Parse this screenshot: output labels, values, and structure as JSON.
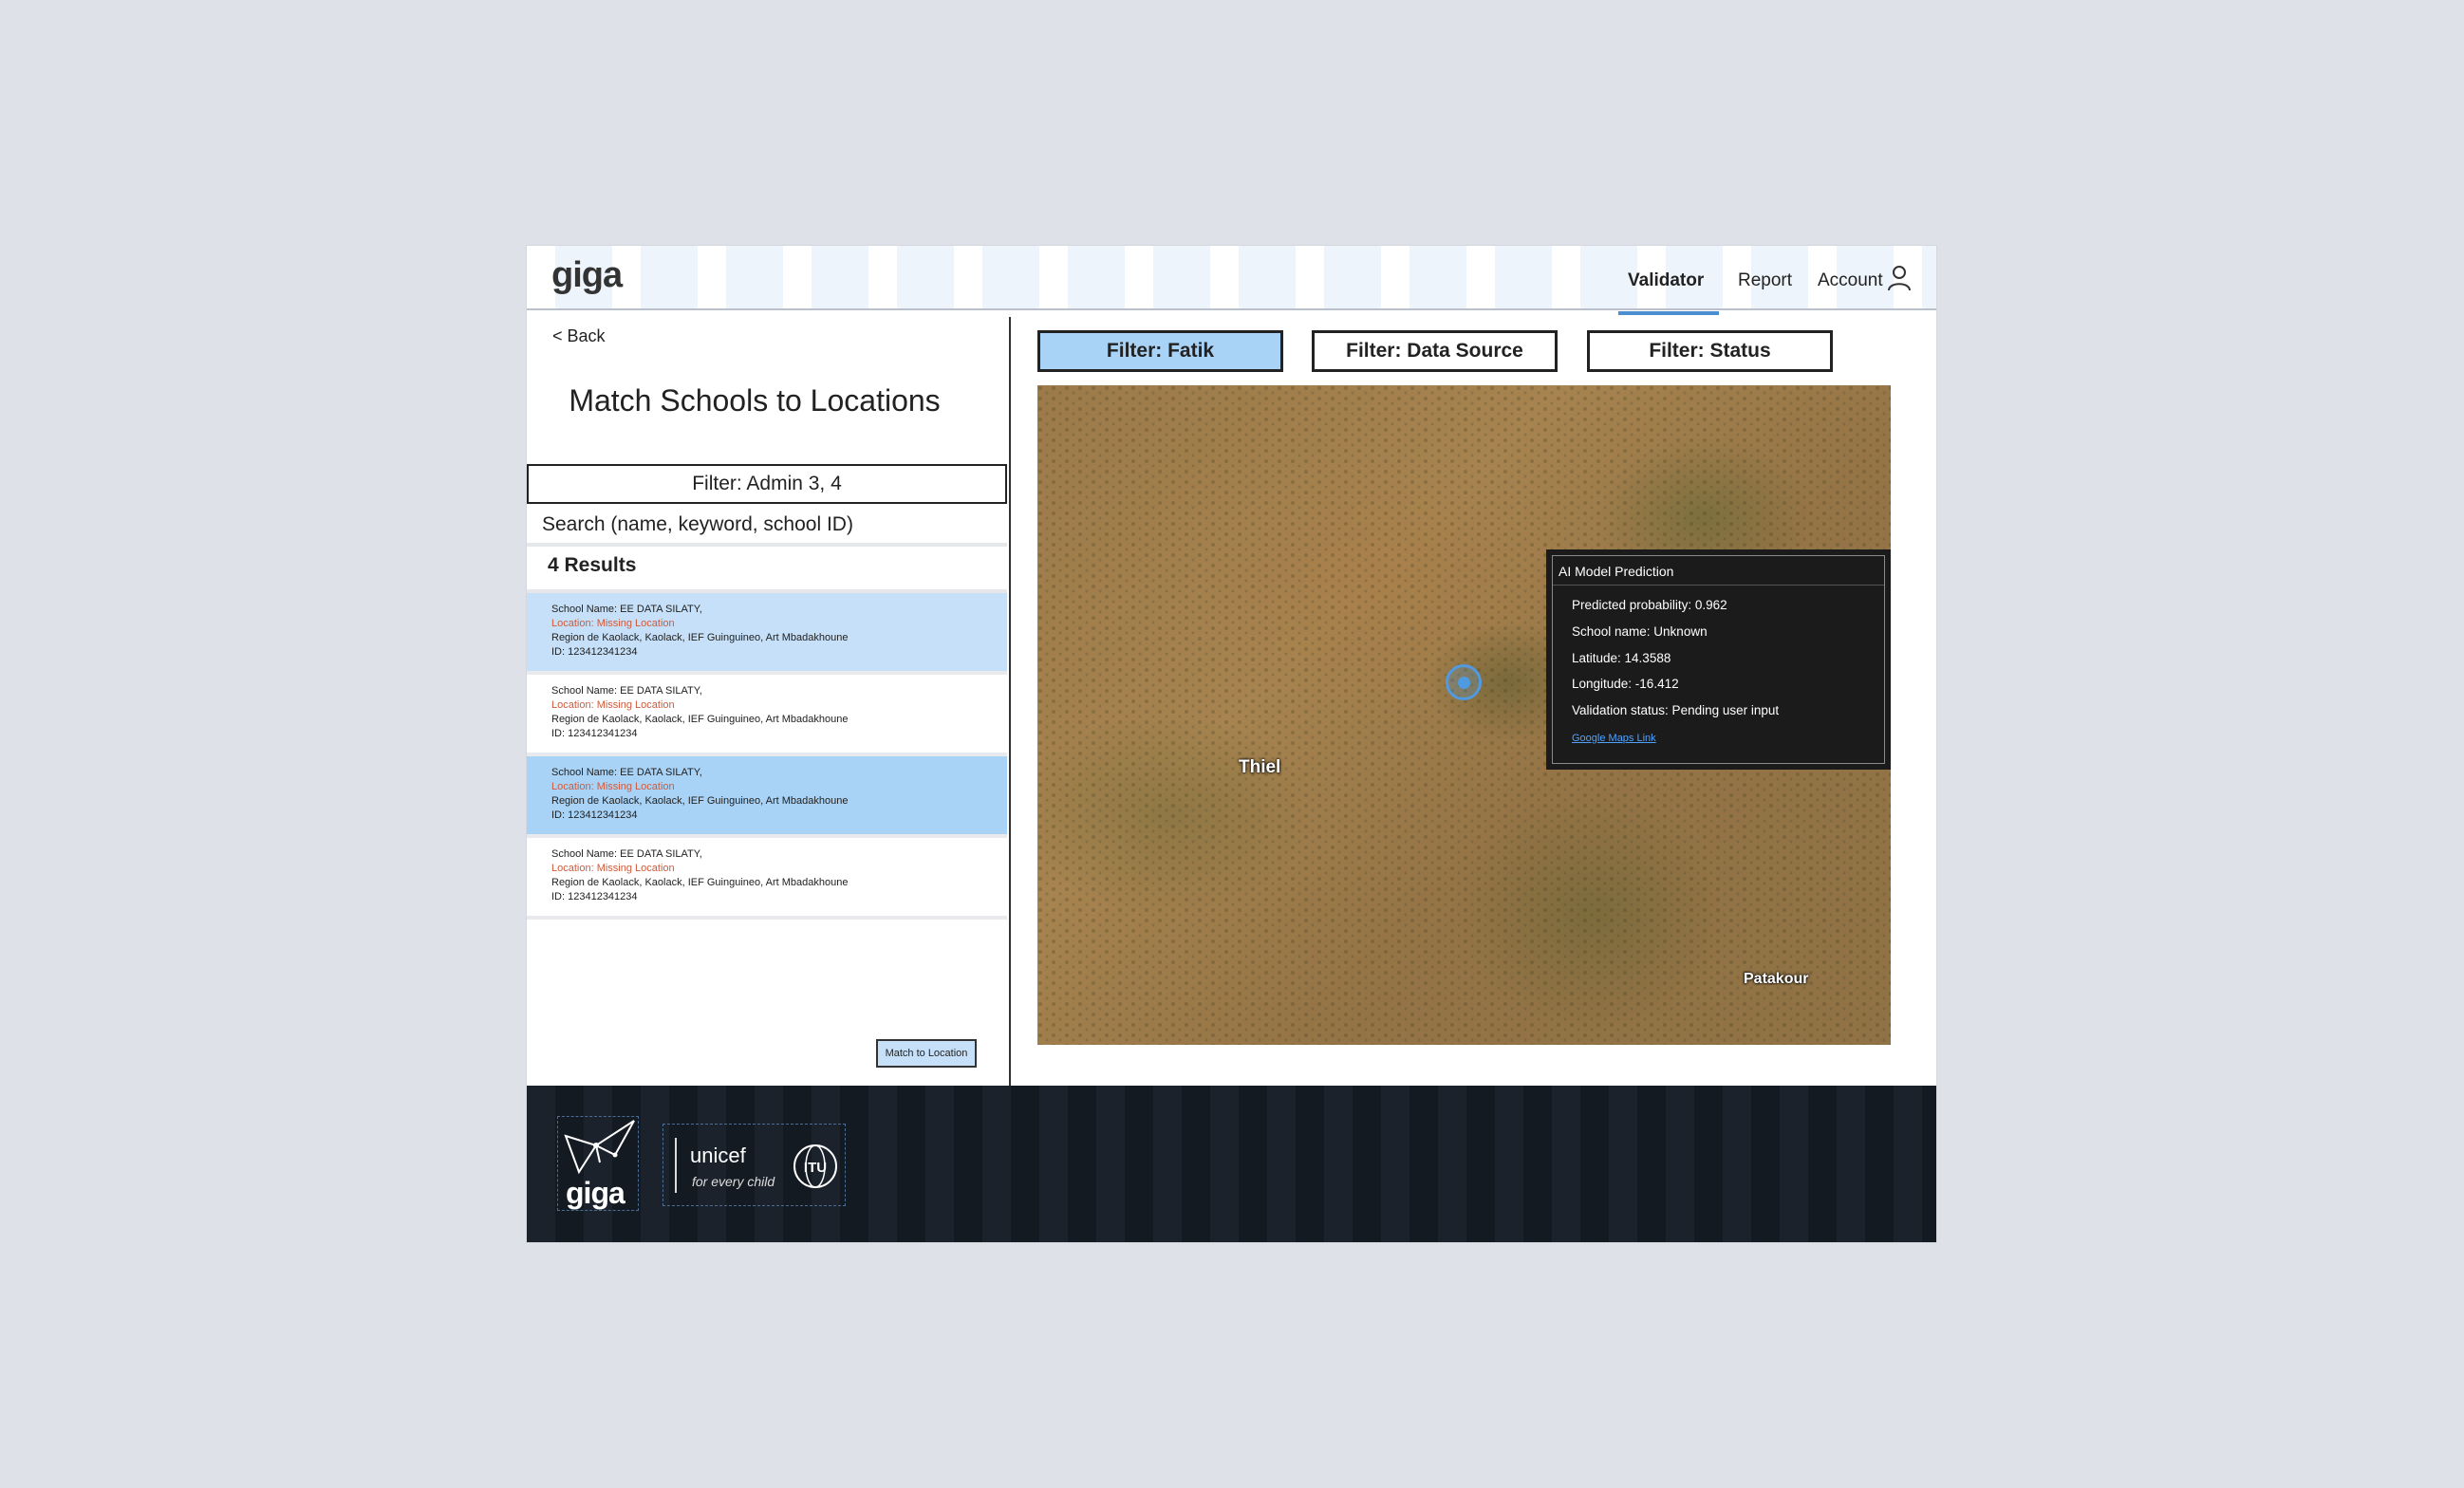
{
  "header": {
    "brand": "giga",
    "nav": {
      "validator": "Validator",
      "report": "Report",
      "account": "Account"
    }
  },
  "left_panel": {
    "back": "< Back",
    "title": "Match Schools to Locations",
    "admin_filter": "Filter: Admin 3, 4",
    "search_placeholder": "Search (name, keyword, school ID)",
    "results_count": "4 Results",
    "results": [
      {
        "name": "School Name: EE DATA SILATY,",
        "location": "Location: Missing Location",
        "region": "Region de Kaolack, Kaolack, IEF Guinguineo, Art Mbadakhoune",
        "id": "ID: 123412341234"
      },
      {
        "name": "School Name: EE DATA SILATY,",
        "location": "Location: Missing Location",
        "region": "Region de Kaolack, Kaolack, IEF Guinguineo, Art Mbadakhoune",
        "id": "ID: 123412341234"
      },
      {
        "name": "School Name: EE DATA SILATY,",
        "location": "Location: Missing Location",
        "region": "Region de Kaolack, Kaolack, IEF Guinguineo, Art Mbadakhoune",
        "id": "ID: 123412341234"
      },
      {
        "name": "School Name: EE DATA SILATY,",
        "location": "Location: Missing Location",
        "region": "Region de Kaolack, Kaolack, IEF Guinguineo, Art Mbadakhoune",
        "id": "ID: 123412341234"
      }
    ],
    "match_button": "Match to Location"
  },
  "filters": {
    "fatik": "Filter: Fatik",
    "data_source": "Filter: Data Source",
    "status": "Filter: Status"
  },
  "map": {
    "places": {
      "thiel": "Thiel",
      "patakour": "Patakour"
    },
    "popup": {
      "title": "AI Model Prediction",
      "probability": "Predicted probability: 0.962",
      "school_name": "School name: Unknown",
      "latitude": "Latitude: 14.3588",
      "longitude": "Longitude: -16.412",
      "status": "Validation status: Pending user input",
      "link": "Google Maps Link"
    }
  },
  "footer": {
    "giga": "giga",
    "unicef": "unicef",
    "unicef_tagline": "for every child",
    "itu": "ITU"
  },
  "colors": {
    "accent_blue": "#4b8fd1",
    "selected_row": "#c5e0f8",
    "selected_row_strong": "#a8d3f6",
    "missing_location": "#d05a3b",
    "footer_bg": "#1b222c"
  }
}
